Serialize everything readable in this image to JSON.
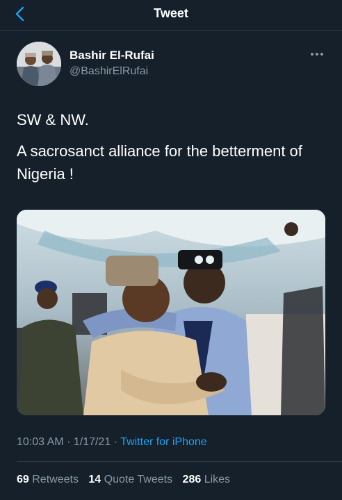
{
  "header": {
    "title": "Tweet"
  },
  "author": {
    "display_name": "Bashir El-Rufai",
    "handle": "@BashirElRufai"
  },
  "tweet": {
    "line1": "SW & NW.",
    "line2": "A sacrosanct alliance for the betterment of Nigeria !"
  },
  "meta": {
    "time": "10:03 AM",
    "date": "1/17/21",
    "separator": "·",
    "source": "Twitter for iPhone"
  },
  "stats": {
    "retweets_count": "69",
    "retweets_label": "Retweets",
    "quotes_count": "14",
    "quotes_label": "Quote Tweets",
    "likes_count": "286",
    "likes_label": "Likes"
  },
  "colors": {
    "background": "#15202b",
    "accent": "#1da1f2",
    "secondary": "#8899a6",
    "divider": "#2f3b47"
  },
  "icons": {
    "back": "chevron-left-icon",
    "more": "more-horizontal-icon"
  }
}
